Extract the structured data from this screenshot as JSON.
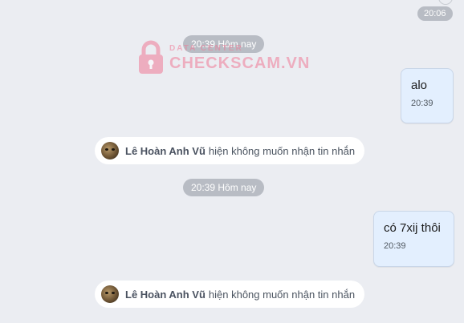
{
  "messages": {
    "top_time": "20:06",
    "divider_1": "20:39 Hôm nay",
    "bubble_1": {
      "text": "alo",
      "time": "20:39"
    },
    "notice_1": {
      "name": "Lê Hoàn Anh Vũ",
      "text": "hiện không muốn nhận tin nhắn"
    },
    "divider_2": "20:39 Hôm nay",
    "bubble_2": {
      "text": "có 7xij thôi",
      "time": "20:39"
    },
    "notice_2": {
      "name": "Lê Hoàn Anh Vũ",
      "text": "hiện không muốn nhận tin nhắn"
    }
  },
  "watermark": {
    "small_text": "DATA CENTER",
    "brand_text": "CHECKSCAM.VN",
    "icon": "lock-icon",
    "color": "#f07a96"
  },
  "colors": {
    "background": "#ebedf2",
    "bubble": "#e3effe",
    "time_pill": "#b8bcc4"
  }
}
